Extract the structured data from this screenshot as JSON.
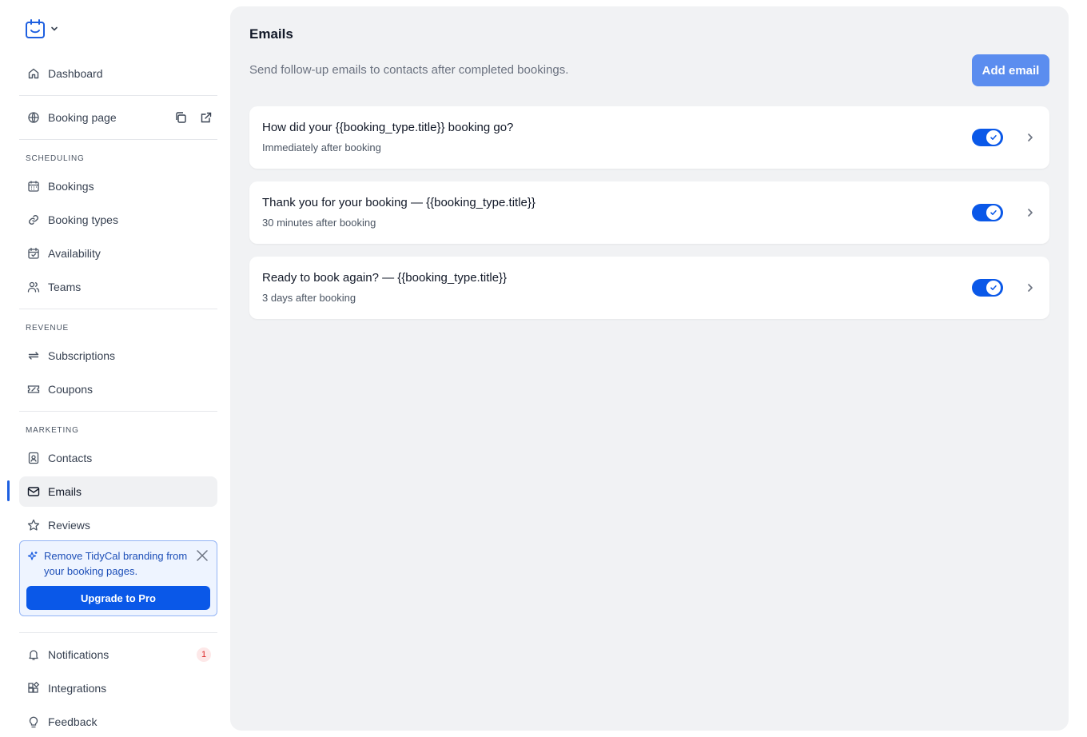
{
  "sidebar": {
    "nav": {
      "dashboard": "Dashboard",
      "booking_page": "Booking page",
      "bookings": "Bookings",
      "booking_types": "Booking types",
      "availability": "Availability",
      "teams": "Teams",
      "subscriptions": "Subscriptions",
      "coupons": "Coupons",
      "contacts": "Contacts",
      "emails": "Emails",
      "reviews": "Reviews",
      "notifications": "Notifications",
      "integrations": "Integrations",
      "feedback": "Feedback"
    },
    "sections": {
      "scheduling": "SCHEDULING",
      "revenue": "REVENUE",
      "marketing": "MARKETING"
    },
    "active_item": "Emails",
    "notifications_count": "1",
    "promo": {
      "text": "Remove TidyCal branding from your booking pages.",
      "button": "Upgrade to Pro"
    }
  },
  "main": {
    "title": "Emails",
    "description": "Send follow-up emails to contacts after completed bookings.",
    "add_button": "Add email",
    "emails": [
      {
        "title": "How did your {{booking_type.title}} booking go?",
        "timing": "Immediately after booking",
        "enabled": true
      },
      {
        "title": "Thank you for your booking — {{booking_type.title}}",
        "timing": "30 minutes after booking",
        "enabled": true
      },
      {
        "title": "Ready to book again? — {{booking_type.title}}",
        "timing": "3 days after booking",
        "enabled": true
      }
    ]
  },
  "colors": {
    "accent": "#0a58e8",
    "add_button": "#5b8def",
    "main_bg": "#f1f2f4",
    "badge_bg": "#fde8e8",
    "badge_text": "#dc2626"
  }
}
